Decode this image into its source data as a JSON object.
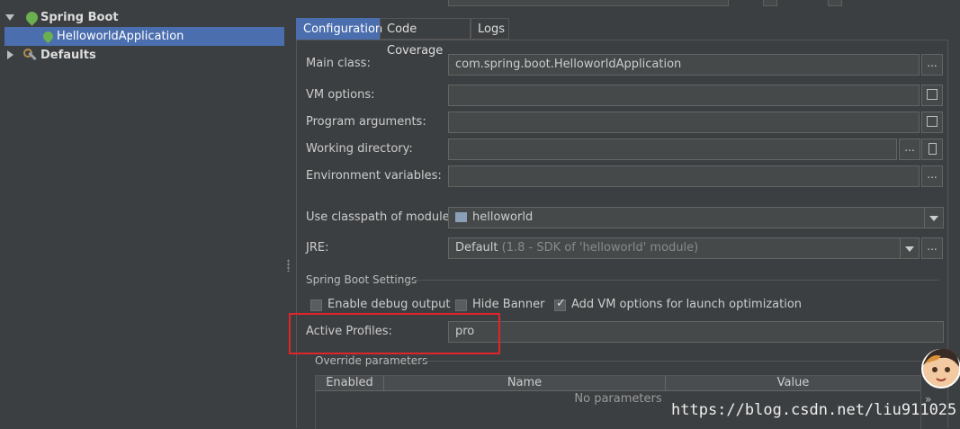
{
  "tree": {
    "root": {
      "label": "Spring Boot",
      "expanded": true
    },
    "child": {
      "label": "HelloworldApplication",
      "selected": true
    },
    "defaults": {
      "label": "Defaults",
      "expanded": false
    }
  },
  "tabs": [
    {
      "label": "Configuration",
      "active": true
    },
    {
      "label": "Code Coverage",
      "active": false
    },
    {
      "label": "Logs",
      "active": false
    }
  ],
  "form": {
    "main_class": {
      "label": "Main class:",
      "value": "com.spring.boot.HelloworldApplication"
    },
    "vm_options": {
      "label": "VM options:",
      "value": ""
    },
    "program_arguments": {
      "label": "Program arguments:",
      "value": ""
    },
    "working_directory": {
      "label": "Working directory:",
      "value": ""
    },
    "environment_variables": {
      "label": "Environment variables:",
      "value": ""
    },
    "classpath_module": {
      "label": "Use classpath of module:",
      "value": "helloworld"
    },
    "jre": {
      "label": "JRE:",
      "value": "Default",
      "value_hint": "(1.8 - SDK of 'helloworld' module)"
    }
  },
  "spring_boot_settings": {
    "title": "Spring Boot Settings",
    "enable_debug_output": {
      "label": "Enable debug output",
      "checked": false
    },
    "hide_banner": {
      "label": "Hide Banner",
      "checked": false
    },
    "add_vm_options": {
      "label": "Add VM options for launch optimization",
      "checked": true
    },
    "active_profiles": {
      "label": "Active Profiles:",
      "value": "pro"
    }
  },
  "override_parameters": {
    "title": "Override parameters",
    "columns": [
      "Enabled",
      "Name",
      "Value"
    ],
    "empty_text": "No parameters"
  },
  "watermark": "https://blog.csdn.net/liu911025",
  "buttons": {
    "ellipsis": "...",
    "more": "»"
  },
  "colors": {
    "selection": "#4b6eaf",
    "highlight_box": "#e0242a",
    "spring_leaf": "#6aaf50"
  },
  "icons": [
    "spring-boot-icon",
    "spring-app-icon",
    "defaults-icon",
    "expand-icon",
    "folder-module-icon",
    "dropdown-icon"
  ]
}
